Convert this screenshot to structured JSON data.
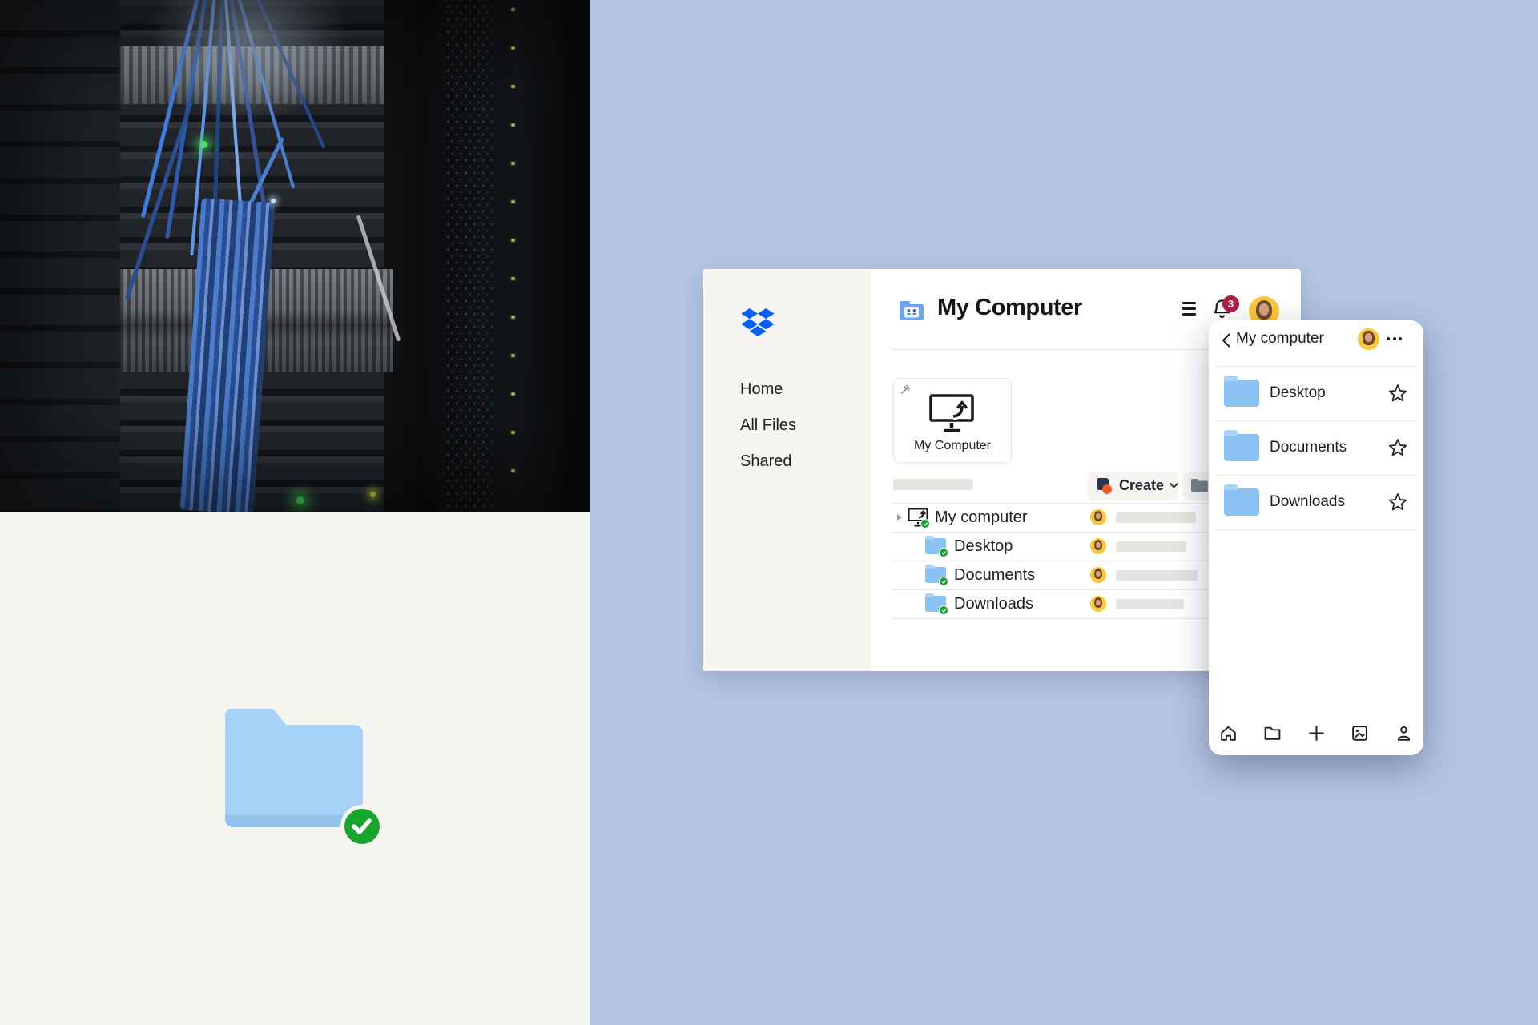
{
  "win": {
    "sidebar": {
      "items": [
        "Home",
        "All Files",
        "Shared"
      ]
    },
    "header": {
      "title": "My Computer",
      "badge": "3"
    },
    "card": {
      "label": "My Computer"
    },
    "toolbar": {
      "create": "Create"
    },
    "rows": [
      {
        "name": "My computer"
      },
      {
        "name": "Desktop"
      },
      {
        "name": "Documents"
      },
      {
        "name": "Downloads"
      }
    ]
  },
  "mobile": {
    "title": "My computer",
    "rows": [
      {
        "name": "Desktop"
      },
      {
        "name": "Documents"
      },
      {
        "name": "Downloads"
      }
    ]
  },
  "icons": {
    "brand": "dropbox-logo",
    "window_header": [
      "shared-folder-icon",
      "hamburger-menu-icon",
      "bell-icon",
      "avatar"
    ],
    "card": [
      "pin-icon",
      "computer-sync-icon"
    ],
    "toolbar": [
      "create-brand-mark",
      "chevron-down-icon",
      "folder-upload-icon"
    ],
    "rows": [
      "disclosure-caret",
      "computer-sync-icon",
      "folder-sync-icon"
    ],
    "mobile_header": [
      "back-chevron-icon",
      "avatar",
      "overflow-menu-icon"
    ],
    "mobile_rows": [
      "folder-icon",
      "star-icon"
    ],
    "mobile_nav": [
      "home-icon",
      "folder-icon",
      "plus-icon",
      "photos-icon",
      "account-icon"
    ],
    "artwork": [
      "server-rack-photo",
      "synced-folder-illustration",
      "check-badge-icon"
    ]
  },
  "colors": {
    "background_blue": "#b3c5e2",
    "cream": "#f7f5f0",
    "dropbox_blue": "#0061fe",
    "folder_blue": "#8ac2f3",
    "folder_blue_light": "#a9d4f8",
    "success_green": "#17a52e",
    "badge_red": "#b01e43",
    "avatar_yellow": "#fbc737",
    "create_navy": "#2a3547",
    "create_orange": "#f15b2a",
    "text_dark": "#1f1e1c",
    "skeleton_gray": "#e6e4e0"
  }
}
